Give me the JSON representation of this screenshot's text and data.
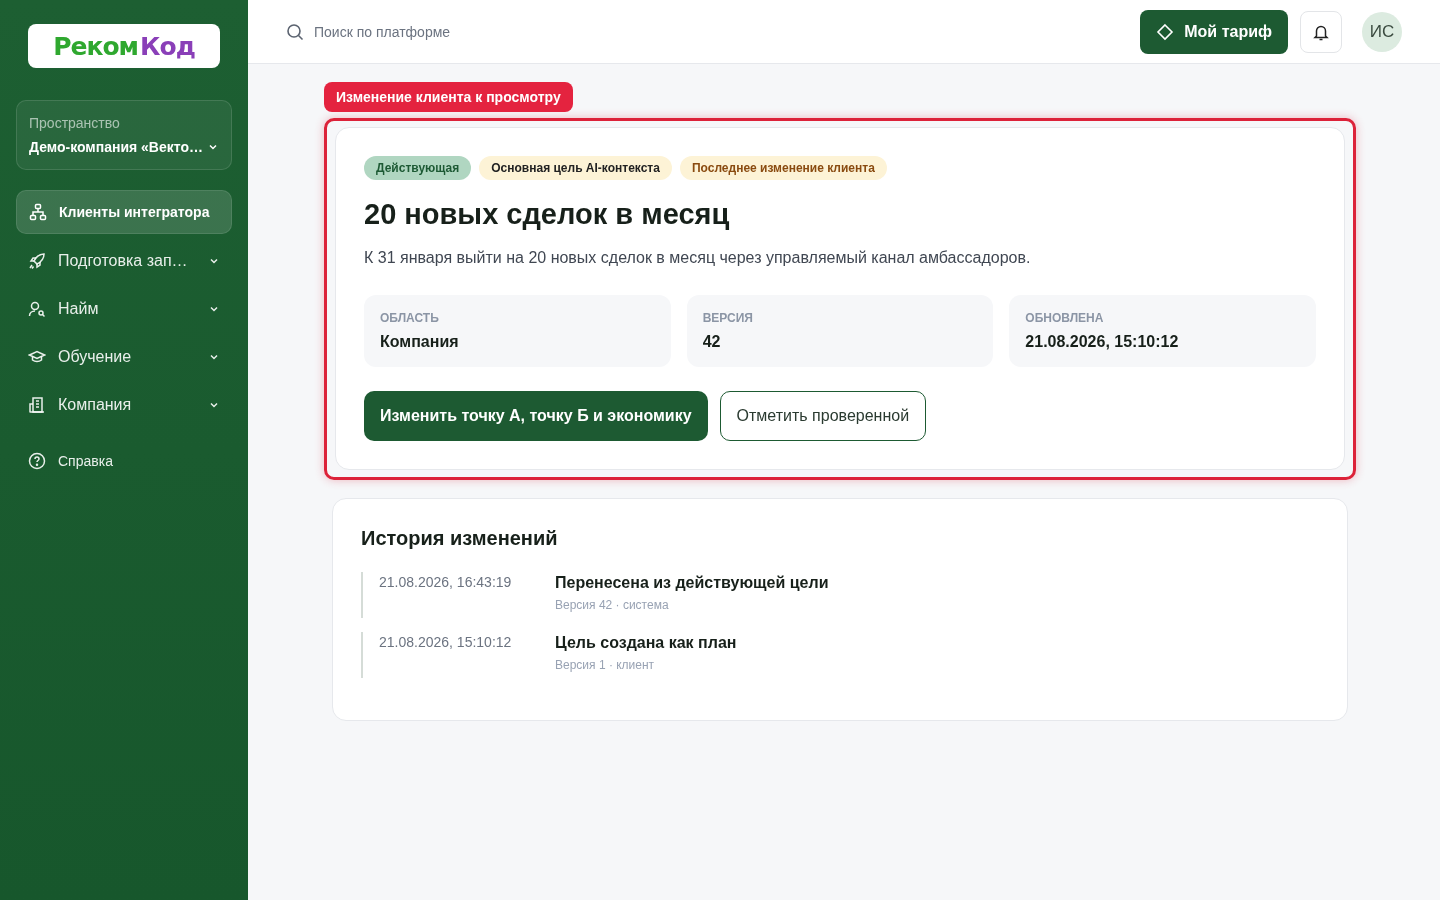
{
  "sidebar": {
    "logo": [
      {
        "text": "Реком",
        "color": "#2fa82f"
      },
      {
        "text": "Код",
        "color": "#8a3fb8"
      }
    ],
    "workspace": {
      "label": "Пространство",
      "value": "Демо-компания «Векто…"
    },
    "items": [
      {
        "label": "Клиенты интегратора",
        "selected": true,
        "expandable": false
      },
      {
        "label": "Подготовка зап…",
        "selected": false,
        "expandable": true
      },
      {
        "label": "Найм",
        "selected": false,
        "expandable": true
      },
      {
        "label": "Обучение",
        "selected": false,
        "expandable": true
      },
      {
        "label": "Компания",
        "selected": false,
        "expandable": true
      }
    ],
    "help": {
      "label": "Справка"
    }
  },
  "header": {
    "search": {
      "placeholder": "Поиск по платформе"
    },
    "plan_button": "Мой тариф",
    "avatar": "ИС"
  },
  "goal": {
    "highlighted": true,
    "highlight_label": "Изменение клиента к просмотру",
    "tags": [
      {
        "label": "Действующая",
        "color": "#1d5a34"
      },
      {
        "label": "Основная цель AI-контекста",
        "color": "#222222"
      },
      {
        "label": "Последнее изменение клиента",
        "color": "#8a4b10"
      }
    ],
    "title": "20 новых сделок в месяц",
    "description": "К 31 января выйти на 20 новых сделок в месяц через управляемый канал амбассадоров.",
    "facts": [
      {
        "label": "ОБЛАСТЬ",
        "value": "Компания"
      },
      {
        "label": "ВЕРСИЯ",
        "value": "42"
      },
      {
        "label": "ОБНОВЛЕНА",
        "value": "21.08.2026, 15:10:12"
      }
    ],
    "buttons": [
      {
        "label": "Изменить точку А, точку Б и экономику",
        "kind": "primary"
      },
      {
        "label": "Отметить проверенной",
        "kind": "outline"
      }
    ]
  },
  "history": {
    "title": "История изменений",
    "entries": [
      {
        "time": "21.08.2026, 16:43:19",
        "title": "Перенесена из действующей цели",
        "meta": "Версия 42 · система"
      },
      {
        "time": "21.08.2026, 15:10:12",
        "title": "Цель создана как план",
        "meta": "Версия 1 · клиент"
      }
    ]
  }
}
